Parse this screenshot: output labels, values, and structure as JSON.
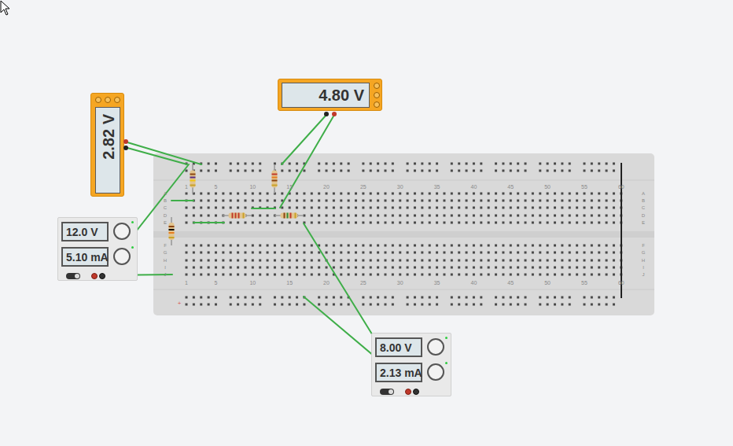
{
  "multimeters": [
    {
      "reading": "2.82 V",
      "kind": "vertical"
    },
    {
      "reading": "4.80 V",
      "kind": "horizontal"
    }
  ],
  "power_supplies": [
    {
      "voltage": "12.0 V",
      "current": "5.10 mA",
      "on": true
    },
    {
      "voltage": "8.00 V",
      "current": "2.13 mA",
      "on": true
    }
  ],
  "breadboard": {
    "column_numbers": [
      "1",
      "5",
      "10",
      "15",
      "20",
      "25",
      "30",
      "35",
      "40",
      "45",
      "50",
      "55",
      "60"
    ],
    "row_letters_top": [
      "A",
      "B",
      "C",
      "D",
      "E"
    ],
    "row_letters_bottom": [
      "F",
      "G",
      "H",
      "I",
      "J"
    ],
    "rail_label": "+"
  },
  "resistors": [
    {
      "bands": [
        "#8b4513",
        "#5b2c83",
        "#f1c40f",
        "#c9a227"
      ]
    },
    {
      "bands": [
        "#8b4513",
        "#000000",
        "#e67e22",
        "#c9a227"
      ]
    },
    {
      "bands": [
        "#c0392b",
        "#c0392b",
        "#c0392b",
        "#c9a227"
      ]
    },
    {
      "bands": [
        "#8b4513",
        "#2e8b3d",
        "#c0392b",
        "#c9a227"
      ]
    },
    {
      "bands": [
        "#c0392b",
        "#e67e22",
        "#8b4513",
        "#c9a227"
      ]
    }
  ]
}
